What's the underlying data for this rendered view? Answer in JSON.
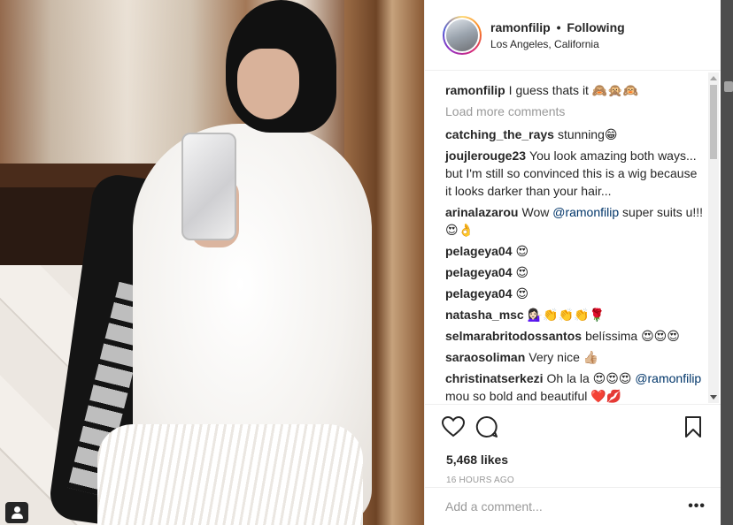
{
  "post": {
    "username": "ramonfilip",
    "follow_separator": "•",
    "follow_status": "Following",
    "location": "Los Angeles, California"
  },
  "caption": {
    "username": "ramonfilip",
    "text": "I guess thats it 🙈🙊🙉"
  },
  "load_more_label": "Load more comments",
  "comments": [
    {
      "user": "catching_the_rays",
      "text": "stunning😁"
    },
    {
      "user": "joujlerouge23",
      "text": "You look amazing both ways... but I'm still so convinced this is a wig because it looks darker than your hair..."
    },
    {
      "user": "arinalazarou",
      "text_before": "Wow",
      "mention": "@ramonfilip",
      "text_after": "super suits u!!! 😍👌"
    },
    {
      "user": "pelageya04",
      "text": "😍"
    },
    {
      "user": "pelageya04",
      "text": "😍"
    },
    {
      "user": "pelageya04",
      "text": "😍"
    },
    {
      "user": "natasha_msc",
      "text": "💁🏻‍♀️👏👏👏🌹"
    },
    {
      "user": "selmarabritodossantos",
      "text": "belíssima 😍😍😍"
    },
    {
      "user": "saraosoliman",
      "text": "Very nice 👍🏼"
    },
    {
      "user": "christinatserkezi",
      "text": "Oh la la 😍😍😍",
      "mention": "@ramonfilip",
      "text_after": "mou so bold and beautiful ❤️💋"
    }
  ],
  "stats": {
    "likes": "5,468 likes",
    "time": "16 HOURS AGO"
  },
  "add_comment": {
    "placeholder": "Add a comment...",
    "more_label": "•••"
  },
  "icons": {
    "like": "heart-icon",
    "comment": "comment-bubble-icon",
    "save": "bookmark-icon",
    "tag": "user-tag-icon"
  }
}
